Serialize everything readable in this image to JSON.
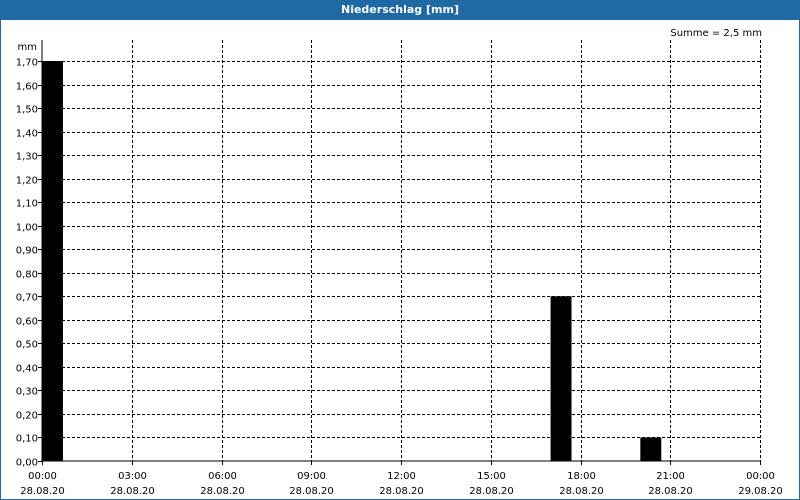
{
  "window": {
    "title": "Niederschlag [mm]"
  },
  "summary": "Summe = 2,5 mm",
  "colors": {
    "titlebar": "#1f6aa5",
    "bar": "#000000",
    "grid": "#000000"
  },
  "chart_data": {
    "type": "bar",
    "title": "Niederschlag [mm]",
    "ylabel": "mm",
    "ylim": [
      0,
      1.7
    ],
    "yticks": [
      "0,00",
      "0,10",
      "0,20",
      "0,30",
      "0,40",
      "0,50",
      "0,60",
      "0,70",
      "0,80",
      "0,90",
      "1,00",
      "1,10",
      "1,20",
      "1,30",
      "1,40",
      "1,50",
      "1,60",
      "1,70"
    ],
    "xlim_hours": [
      0,
      24
    ],
    "xticks": [
      {
        "time": "00:00",
        "date": "28.08.20"
      },
      {
        "time": "03:00",
        "date": "28.08.20"
      },
      {
        "time": "06:00",
        "date": "28.08.20"
      },
      {
        "time": "09:00",
        "date": "28.08.20"
      },
      {
        "time": "12:00",
        "date": "28.08.20"
      },
      {
        "time": "15:00",
        "date": "28.08.20"
      },
      {
        "time": "18:00",
        "date": "28.08.20"
      },
      {
        "time": "21:00",
        "date": "28.08.20"
      },
      {
        "time": "00:00",
        "date": "29.08.20"
      }
    ],
    "bars": [
      {
        "start_hour": 0.0,
        "end_hour": 0.7,
        "value": 1.7
      },
      {
        "start_hour": 17.0,
        "end_hour": 17.7,
        "value": 0.7
      },
      {
        "start_hour": 20.0,
        "end_hour": 20.7,
        "value": 0.1
      }
    ],
    "grid": true
  }
}
